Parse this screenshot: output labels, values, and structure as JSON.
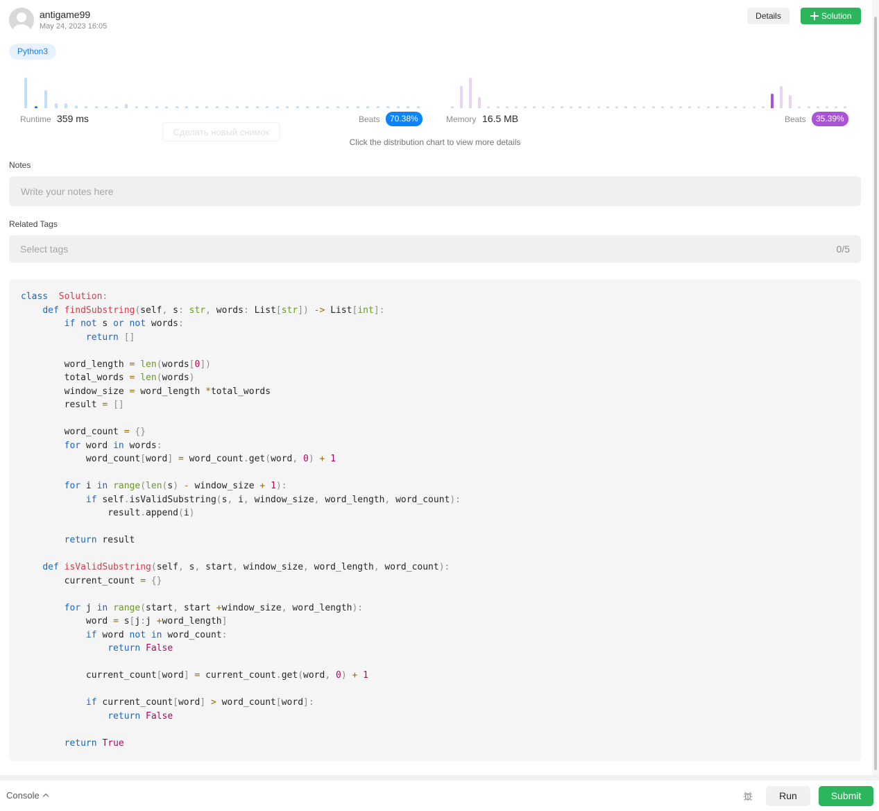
{
  "author": {
    "username": "antigame99",
    "date": "May 24, 2023 16:05"
  },
  "header": {
    "details_label": "Details",
    "solution_label": "Solution"
  },
  "language": "Python3",
  "runtime": {
    "label": "Runtime",
    "value": "359 ms",
    "beats_label": "Beats",
    "beats_value": "70.38%",
    "color": "#0a84ff",
    "distribution": [
      0.78,
      0.05,
      0.46,
      0.12,
      0.13,
      0.07,
      0.05,
      0.05,
      0.05,
      0.05,
      0.11,
      0.05,
      0.05,
      0.05,
      0.05,
      0.05,
      0.05,
      0.05,
      0.05,
      0.05,
      0.05,
      0.05,
      0.05,
      0.05,
      0.05,
      0.05,
      0.05,
      0.05,
      0.05,
      0.05,
      0.05,
      0.05,
      0.05,
      0.05,
      0.05,
      0.05,
      0.05,
      0.05,
      0.05,
      0.05
    ],
    "highlight_index": 1
  },
  "memory": {
    "label": "Memory",
    "value": "16.5 MB",
    "beats_label": "Beats",
    "beats_value": "35.39%",
    "color": "#a953d6",
    "distribution": [
      0.05,
      0.57,
      0.78,
      0.29,
      0.05,
      0.05,
      0.05,
      0.05,
      0.05,
      0.05,
      0.05,
      0.05,
      0.05,
      0.05,
      0.05,
      0.05,
      0.05,
      0.05,
      0.05,
      0.05,
      0.05,
      0.05,
      0.05,
      0.05,
      0.05,
      0.05,
      0.05,
      0.05,
      0.05,
      0.05,
      0.05,
      0.05,
      0.05,
      0.05,
      0.05,
      0.38,
      0.57,
      0.34,
      0.05,
      0.05,
      0.05,
      0.05,
      0.05,
      0.05
    ],
    "highlight_index": 35
  },
  "ghost_tooltip": "Сделать новый снимок",
  "hint": "Click the distribution chart to view more details",
  "notes": {
    "label": "Notes",
    "placeholder": "Write your notes here"
  },
  "tags": {
    "label": "Related Tags",
    "placeholder": "Select tags",
    "count": "0/5"
  },
  "code_lines": [
    [
      [
        "kw",
        "class"
      ],
      [
        "",
        "  "
      ],
      [
        "cls",
        "Solution"
      ],
      [
        "pu",
        ":"
      ]
    ],
    [
      [
        "",
        "    "
      ],
      [
        "kw",
        "def"
      ],
      [
        "",
        ""
      ],
      [
        "fn",
        "findSubstring"
      ],
      [
        "pu",
        "("
      ],
      [
        "",
        "self"
      ],
      [
        "pu",
        ","
      ],
      [
        "",
        ""
      ],
      [
        "",
        "s"
      ],
      [
        "pu",
        ":"
      ],
      [
        "",
        ""
      ],
      [
        "bi",
        "str"
      ],
      [
        "pu",
        ","
      ],
      [
        "",
        ""
      ],
      [
        "",
        "words"
      ],
      [
        "pu",
        ":"
      ],
      [
        "",
        ""
      ],
      [
        "",
        "List"
      ],
      [
        "pu",
        "["
      ],
      [
        "bi",
        "str"
      ],
      [
        "pu",
        "])"
      ],
      [
        "",
        ""
      ],
      [
        "op",
        "->"
      ],
      [
        "",
        ""
      ],
      [
        "",
        "List"
      ],
      [
        "pu",
        "["
      ],
      [
        "bi",
        "int"
      ],
      [
        "pu",
        "]:"
      ]
    ],
    [
      [
        "",
        "        "
      ],
      [
        "kw",
        "if"
      ],
      [
        "",
        ""
      ],
      [
        "kw",
        "not"
      ],
      [
        "",
        "s"
      ],
      [
        "kw",
        "or"
      ],
      [
        "kw",
        "not"
      ],
      [
        "",
        "words"
      ],
      [
        "pu",
        ":"
      ]
    ],
    [
      [
        "",
        "            "
      ],
      [
        "kw",
        "return"
      ],
      [
        "",
        ""
      ],
      [
        "pu",
        "[]"
      ]
    ],
    [],
    [
      [
        "",
        "        word_length "
      ],
      [
        "op",
        "="
      ],
      [
        "",
        ""
      ],
      [
        "bi",
        "len"
      ],
      [
        "pu",
        "("
      ],
      [
        "",
        "words"
      ],
      [
        "pu",
        "["
      ],
      [
        "num",
        "0"
      ],
      [
        "pu",
        "])"
      ]
    ],
    [
      [
        "",
        "        total_words "
      ],
      [
        "op",
        "="
      ],
      [
        "",
        ""
      ],
      [
        "bi",
        "len"
      ],
      [
        "pu",
        "("
      ],
      [
        "",
        "words"
      ],
      [
        "pu",
        ")"
      ]
    ],
    [
      [
        "",
        "        window_size "
      ],
      [
        "op",
        "="
      ],
      [
        "",
        ""
      ],
      [
        "",
        "word_length"
      ],
      [
        "op",
        "*"
      ],
      [
        "",
        "total_words"
      ]
    ],
    [
      [
        "",
        "        result "
      ],
      [
        "op",
        "="
      ],
      [
        "",
        ""
      ],
      [
        "pu",
        "[]"
      ]
    ],
    [],
    [
      [
        "",
        "        word_count "
      ],
      [
        "op",
        "="
      ],
      [
        "",
        ""
      ],
      [
        "pu",
        "{}"
      ]
    ],
    [
      [
        "",
        "        "
      ],
      [
        "kw",
        "for"
      ],
      [
        "",
        "word"
      ],
      [
        "kw",
        "in"
      ],
      [
        "",
        "words"
      ],
      [
        "pu",
        ":"
      ]
    ],
    [
      [
        "",
        "            word_count"
      ],
      [
        "pu",
        "["
      ],
      [
        "",
        "word"
      ],
      [
        "pu",
        "]"
      ],
      [
        "",
        ""
      ],
      [
        "op",
        "="
      ],
      [
        "",
        ""
      ],
      [
        "",
        "word_count"
      ],
      [
        "pu",
        "."
      ],
      [
        "",
        "get"
      ],
      [
        "pu",
        "("
      ],
      [
        "",
        "word"
      ],
      [
        "pu",
        ","
      ],
      [
        "",
        ""
      ],
      [
        "num",
        "0"
      ],
      [
        "pu",
        ")"
      ],
      [
        "",
        ""
      ],
      [
        "op",
        "+"
      ],
      [
        "",
        ""
      ],
      [
        "num",
        "1"
      ]
    ],
    [],
    [
      [
        "",
        "        "
      ],
      [
        "kw",
        "for"
      ],
      [
        "",
        "i"
      ],
      [
        "kw",
        "in"
      ],
      [
        "bi",
        "range"
      ],
      [
        "pu",
        "("
      ],
      [
        "bi",
        "len"
      ],
      [
        "pu",
        "("
      ],
      [
        "",
        "s"
      ],
      [
        "pu",
        ")"
      ],
      [
        "",
        ""
      ],
      [
        "op",
        "-"
      ],
      [
        "",
        ""
      ],
      [
        "",
        "window_size"
      ],
      [
        "op",
        "+"
      ],
      [
        "num",
        "1"
      ],
      [
        "pu",
        "):"
      ]
    ],
    [
      [
        "",
        "            "
      ],
      [
        "kw",
        "if"
      ],
      [
        "",
        "self"
      ],
      [
        "pu",
        "."
      ],
      [
        "",
        "isValidSubstring"
      ],
      [
        "pu",
        "("
      ],
      [
        "",
        "s"
      ],
      [
        "pu",
        ","
      ],
      [
        "",
        "i"
      ],
      [
        "pu",
        ","
      ],
      [
        "",
        "window_size"
      ],
      [
        "pu",
        ","
      ],
      [
        "",
        "word_length"
      ],
      [
        "pu",
        ","
      ],
      [
        "",
        "word_count"
      ],
      [
        "pu",
        "):"
      ]
    ],
    [
      [
        "",
        "                result"
      ],
      [
        "pu",
        "."
      ],
      [
        "",
        "append"
      ],
      [
        "pu",
        "("
      ],
      [
        "",
        "i"
      ],
      [
        "pu",
        ")"
      ]
    ],
    [],
    [
      [
        "",
        "        "
      ],
      [
        "kw",
        "return"
      ],
      [
        "",
        "result"
      ]
    ],
    [],
    [
      [
        "",
        "    "
      ],
      [
        "kw",
        "def"
      ],
      [
        "",
        ""
      ],
      [
        "fn",
        "isValidSubstring"
      ],
      [
        "pu",
        "("
      ],
      [
        "",
        "self"
      ],
      [
        "pu",
        ","
      ],
      [
        "",
        "s"
      ],
      [
        "pu",
        ","
      ],
      [
        "",
        "start"
      ],
      [
        "pu",
        ","
      ],
      [
        "",
        "window_size"
      ],
      [
        "pu",
        ","
      ],
      [
        "",
        "word_length"
      ],
      [
        "pu",
        ","
      ],
      [
        "",
        "word_count"
      ],
      [
        "pu",
        "):"
      ]
    ],
    [
      [
        "",
        "        current_count "
      ],
      [
        "op",
        "="
      ],
      [
        "",
        ""
      ],
      [
        "pu",
        "{}"
      ]
    ],
    [],
    [
      [
        "",
        "        "
      ],
      [
        "kw",
        "for"
      ],
      [
        "",
        "j"
      ],
      [
        "kw",
        "in"
      ],
      [
        "bi",
        "range"
      ],
      [
        "pu",
        "("
      ],
      [
        "",
        "start"
      ],
      [
        "pu",
        ","
      ],
      [
        "",
        "start"
      ],
      [
        "op",
        "+"
      ],
      [
        "",
        "window_size"
      ],
      [
        "pu",
        ","
      ],
      [
        "",
        "word_length"
      ],
      [
        "pu",
        "):"
      ]
    ],
    [
      [
        "",
        "            word "
      ],
      [
        "op",
        "="
      ],
      [
        "",
        ""
      ],
      [
        "",
        "s"
      ],
      [
        "pu",
        "["
      ],
      [
        "",
        "j"
      ],
      [
        "pu",
        ":"
      ],
      [
        "",
        "j"
      ],
      [
        "op",
        "+"
      ],
      [
        "",
        "word_length"
      ],
      [
        "pu",
        "]"
      ]
    ],
    [
      [
        "",
        "            "
      ],
      [
        "kw",
        "if"
      ],
      [
        "",
        "word"
      ],
      [
        "kw",
        "not"
      ],
      [
        "kw",
        "in"
      ],
      [
        "",
        "word_count"
      ],
      [
        "pu",
        ":"
      ]
    ],
    [
      [
        "",
        "                "
      ],
      [
        "kw",
        "return"
      ],
      [
        "",
        ""
      ],
      [
        "con",
        "False"
      ]
    ],
    [],
    [
      [
        "",
        "            current_count"
      ],
      [
        "pu",
        "["
      ],
      [
        "",
        "word"
      ],
      [
        "pu",
        "]"
      ],
      [
        "",
        ""
      ],
      [
        "op",
        "="
      ],
      [
        "",
        ""
      ],
      [
        "",
        "current_count"
      ],
      [
        "pu",
        "."
      ],
      [
        "",
        "get"
      ],
      [
        "pu",
        "("
      ],
      [
        "",
        "word"
      ],
      [
        "pu",
        ","
      ],
      [
        "",
        ""
      ],
      [
        "num",
        "0"
      ],
      [
        "pu",
        ")"
      ],
      [
        "",
        ""
      ],
      [
        "op",
        "+"
      ],
      [
        "",
        ""
      ],
      [
        "num",
        "1"
      ]
    ],
    [],
    [
      [
        "",
        "            "
      ],
      [
        "kw",
        "if"
      ],
      [
        "",
        "current_count"
      ],
      [
        "pu",
        "["
      ],
      [
        "",
        "word"
      ],
      [
        "pu",
        "]"
      ],
      [
        "",
        ""
      ],
      [
        "op",
        ">"
      ],
      [
        "",
        ""
      ],
      [
        "",
        "word_count"
      ],
      [
        "pu",
        "["
      ],
      [
        "",
        "word"
      ],
      [
        "pu",
        "]:"
      ]
    ],
    [
      [
        "",
        "                "
      ],
      [
        "kw",
        "return"
      ],
      [
        "",
        ""
      ],
      [
        "con",
        "False"
      ]
    ],
    [],
    [
      [
        "",
        "        "
      ],
      [
        "kw",
        "return"
      ],
      [
        "",
        ""
      ],
      [
        "con",
        "True"
      ]
    ]
  ],
  "bottom": {
    "console_label": "Console",
    "run_label": "Run",
    "submit_label": "Submit"
  }
}
